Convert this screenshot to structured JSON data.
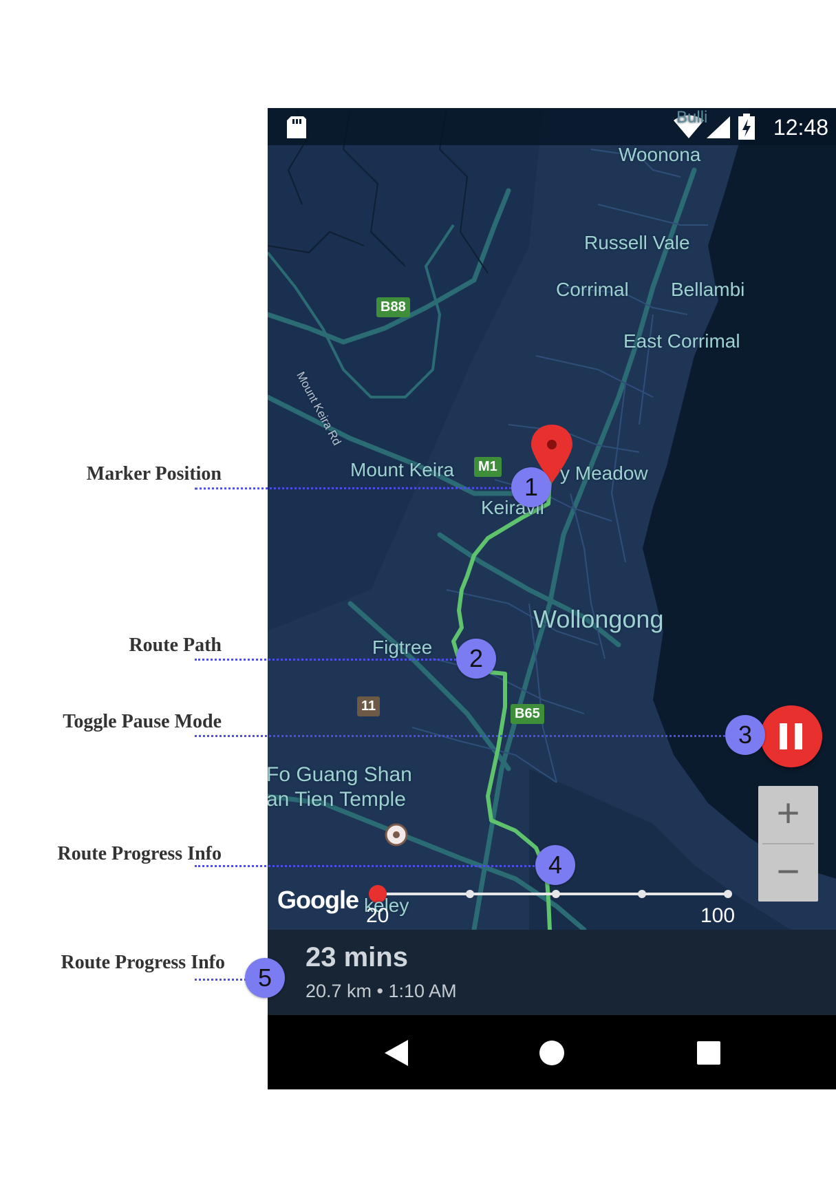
{
  "annotations": [
    {
      "number": "1",
      "label": "Marker Position"
    },
    {
      "number": "2",
      "label": "Route Path"
    },
    {
      "number": "3",
      "label": "Toggle Pause Mode"
    },
    {
      "number": "4",
      "label": "Route Progress Info"
    },
    {
      "number": "5",
      "label": "Route Progress Info"
    }
  ],
  "status_bar": {
    "time": "12:48",
    "icons": [
      "sd-card-icon",
      "wifi-icon",
      "cell-signal-icon",
      "battery-charging-icon"
    ]
  },
  "map": {
    "places": {
      "bulli": "Bulli",
      "woonona": "Woonona",
      "russell_vale": "Russell Vale",
      "corrimal": "Corrimal",
      "bellambi": "Bellambi",
      "east_corrimal": "East Corrimal",
      "mount_keira_rd": "Mount Keira Rd",
      "mount_keira": "Mount Keira",
      "meadow": "y Meadow",
      "keiraville": "Keiravil",
      "wollongong": "Wollongong",
      "figtree": "Figtree",
      "fo_guang_shan": "Fo Guang Shan",
      "nan_tien_temple": "an Tien Temple",
      "berkeley": "keley"
    },
    "shields": {
      "b88": "B88",
      "m1": "M1",
      "b65": "B65",
      "r11": "11"
    },
    "attribution": "Google",
    "colors": {
      "route": "#5fc36d",
      "marker": "#e8302f",
      "water": "#0b1b2e",
      "land": "#1e3556"
    }
  },
  "pause_button": {
    "icon": "pause-icon",
    "color": "#e8302f"
  },
  "zoom": {
    "in": "+",
    "out": "−"
  },
  "progress_slider": {
    "min_label": "20",
    "max_label": "100",
    "value": 0,
    "ticks": 4
  },
  "route_info": {
    "eta": "23 mins",
    "details": "20.7 km • 1:10 AM"
  },
  "nav_bar": {
    "buttons": [
      "back-icon",
      "home-icon",
      "recents-icon"
    ]
  }
}
